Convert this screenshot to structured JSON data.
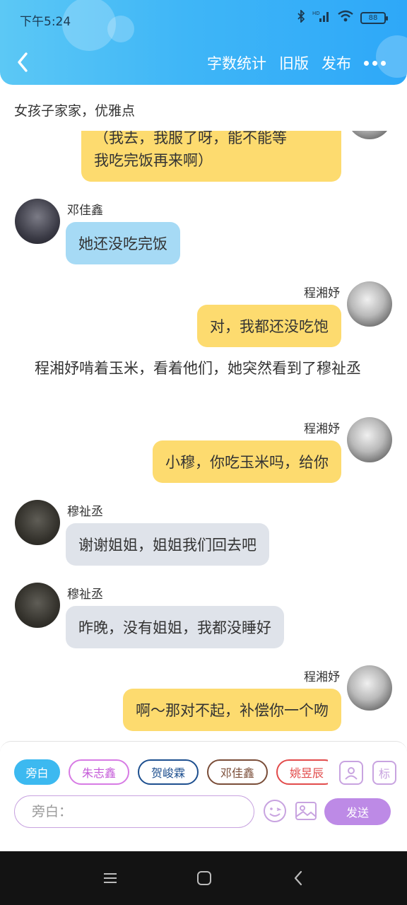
{
  "status_bar": {
    "time": "下午5:24",
    "battery": "88"
  },
  "header": {
    "actions": [
      "字数统计",
      "旧版",
      "发布"
    ]
  },
  "subtitle": "女孩子家家，优雅点",
  "messages": [
    {
      "speaker": "",
      "text_line1": "（我去，我服了呀，能不能等",
      "text_line2": "我吃完饭再来啊）"
    },
    {
      "speaker": "邓佳鑫",
      "text": "她还没吃完饭"
    },
    {
      "speaker": "程湘妤",
      "text": "对，我都还没吃饱"
    },
    {
      "speaker": "程湘妤",
      "text": "小穆，你吃玉米吗，给你"
    },
    {
      "speaker": "穆祉丞",
      "text": "谢谢姐姐，姐姐我们回去吧"
    },
    {
      "speaker": "穆祉丞",
      "text": "昨晚，没有姐姐，我都没睡好"
    },
    {
      "speaker": "程湘妤",
      "text": "啊～那对不起，补偿你一个吻"
    }
  ],
  "narration": "　程湘妤啃着玉米，看着他们，她突然看到了穆祉丞",
  "roles": [
    "旁白",
    "朱志鑫",
    "贺峻霖",
    "邓佳鑫",
    "姚昱辰"
  ],
  "side_icons": {
    "role_icon": "person-icon",
    "tag_label": "标"
  },
  "input": {
    "placeholder": "旁白：",
    "value": ""
  },
  "send_label": "发送",
  "colors": {
    "header": "#3fb6f7",
    "my_bubble": "#fddb6f",
    "blue_bubble": "#a6daf5",
    "gray_bubble": "#dfe3ea",
    "send": "#bd8ae6"
  }
}
